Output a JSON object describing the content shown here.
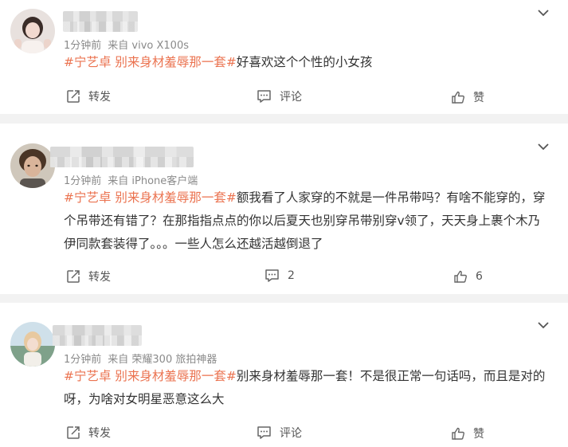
{
  "posts": [
    {
      "meta_time": "1分钟前",
      "meta_source": "来自 vivo X100s",
      "tag": "#宁艺卓 别来身材羞辱那一套#",
      "text": "好喜欢这个个性的小女孩",
      "repost_label": "转发",
      "comment_label": "评论",
      "like_label": "赞"
    },
    {
      "meta_time": "1分钟前",
      "meta_source": "来自 iPhone客户端",
      "tag": "#宁艺卓 别来身材羞辱那一套#",
      "text": "额我看了人家穿的不就是一件吊带吗？有啥不能穿的，穿个吊带还有错了？在那指指点点的你以后夏天也别穿吊带别穿v领了，天天身上裹个木乃伊同款套装得了。。。一些人怎么还越活越倒退了",
      "repost_label": "转发",
      "comment_label": "2",
      "like_label": "6"
    },
    {
      "meta_time": "1分钟前",
      "meta_source": "来自 荣耀300 旅拍神器",
      "tag": "#宁艺卓 别来身材羞辱那一套#",
      "text": "别来身材羞辱那一套！不是很正常一句话吗，而且是对的呀，为啥对女明星恶意这么大",
      "repost_label": "转发",
      "comment_label": "评论",
      "like_label": "赞"
    }
  ],
  "icons": {
    "repost": "repost-icon",
    "comment": "comment-icon",
    "like": "thumbs-up-icon",
    "menu": "chevron-down-icon"
  },
  "colors": {
    "topic": "#eb7350",
    "text": "#333333",
    "meta": "#8a8a8a",
    "divider": "#f2f2f2"
  }
}
